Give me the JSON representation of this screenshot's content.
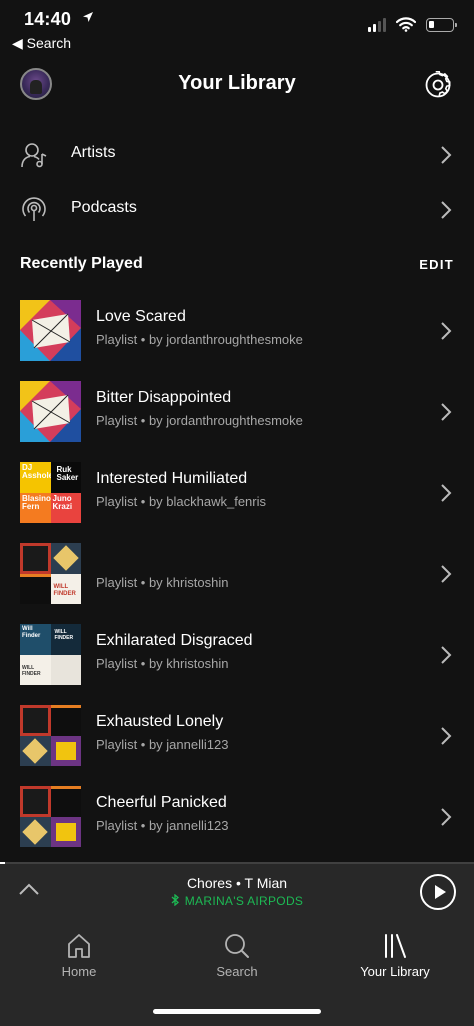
{
  "status_bar": {
    "time": "14:40",
    "back_label": "◀ Search",
    "battery_level": 0.2
  },
  "header": {
    "title": "Your Library"
  },
  "library_nav": [
    {
      "label": "Artists",
      "icon": "artist-icon"
    },
    {
      "label": "Podcasts",
      "icon": "podcast-icon"
    }
  ],
  "recently_played": {
    "title": "Recently Played",
    "edit_label": "EDIT",
    "items": [
      {
        "title": "Love Scared",
        "subtitle": "Playlist • by jordanthroughthesmoke",
        "art": "spotman"
      },
      {
        "title": "Bitter Disappointed",
        "subtitle": "Playlist • by jordanthroughthesmoke",
        "art": "spotman"
      },
      {
        "title": "Interested Humiliated",
        "subtitle": "Playlist • by blackhawk_fenris",
        "art": "colorblocks",
        "art_text": [
          "DJ Asshole",
          "Ruk Saker",
          "Blasino Fern",
          "Juno Krazi"
        ]
      },
      {
        "title": "",
        "subtitle": "Playlist • by khristoshin",
        "art": "mosaic",
        "art_text": [
          "",
          "",
          "",
          "WILL FINDER"
        ]
      },
      {
        "title": "Exhilarated Disgraced",
        "subtitle": "Playlist • by khristoshin",
        "art": "mosaic2",
        "art_text": [
          "Will Finder",
          "WILL FINDER",
          "WILL FINDER",
          ""
        ]
      },
      {
        "title": "Exhausted Lonely",
        "subtitle": "Playlist • by jannelli123",
        "art": "mosaic",
        "art_text": [
          "",
          "",
          "",
          ""
        ]
      },
      {
        "title": "Cheerful Panicked",
        "subtitle": "Playlist • by jannelli123",
        "art": "mosaic",
        "art_text": [
          "",
          "",
          "",
          ""
        ]
      }
    ]
  },
  "now_playing": {
    "track": "Chores",
    "separator": "•",
    "artist": "T Mian",
    "device": "MARINA'S AIRPODS",
    "progress": 0.01,
    "accent_color": "#1db954"
  },
  "tabs": [
    {
      "label": "Home",
      "icon": "home-icon",
      "active": false
    },
    {
      "label": "Search",
      "icon": "search-icon",
      "active": false
    },
    {
      "label": "Your Library",
      "icon": "library-icon",
      "active": true
    }
  ]
}
